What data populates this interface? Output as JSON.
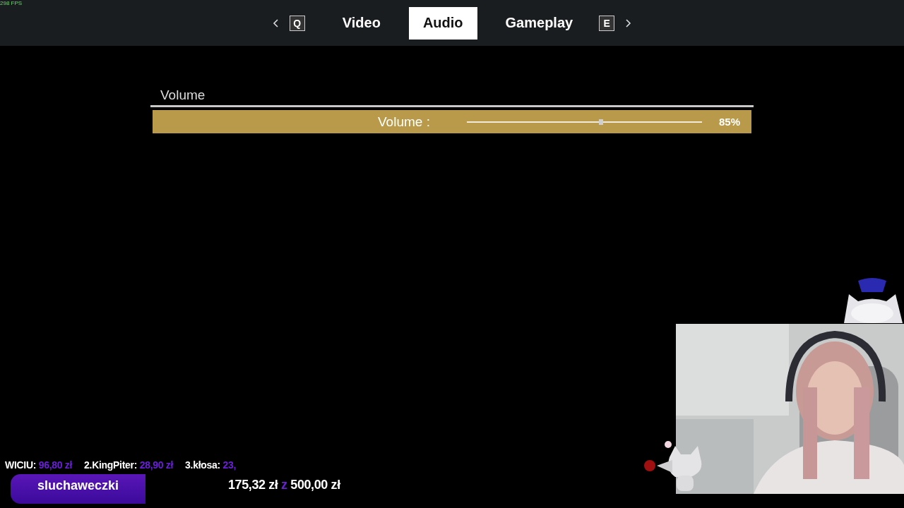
{
  "fps": "298 FPS",
  "tabs": {
    "prev_key": "Q",
    "next_key": "E",
    "items": [
      {
        "label": "Video",
        "selected": false
      },
      {
        "label": "Audio",
        "selected": true
      },
      {
        "label": "Gameplay",
        "selected": false
      }
    ]
  },
  "section": {
    "title": "Volume",
    "settings": [
      {
        "label": "Volume :",
        "level": 0.57,
        "reading": "85%"
      }
    ]
  },
  "overlay": {
    "top_donors": [
      {
        "name": "WICIU:",
        "amount": "96,80 zł"
      },
      {
        "name": "2.KingPiter:",
        "amount": "28,90 zł"
      },
      {
        "name": "3.kłosa:",
        "amount": "23,"
      }
    ],
    "goal": {
      "title": "sluchaweczki",
      "current": "175,32 zł",
      "separator": "z",
      "target": "500,00 zł"
    }
  }
}
